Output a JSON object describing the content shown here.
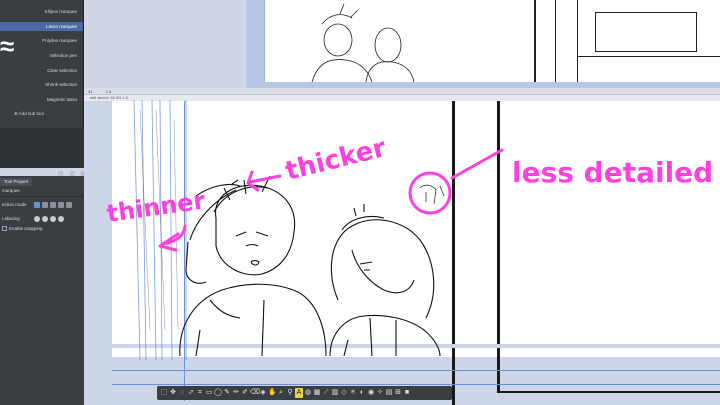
{
  "subtool_panel": {
    "items": [
      {
        "label": "Ellipse marquee"
      },
      {
        "label": "Lasso marquee"
      },
      {
        "label": "Polyline marquee"
      },
      {
        "label": "Selection pen"
      },
      {
        "label": "Clear selection"
      },
      {
        "label": "Shrink selection"
      },
      {
        "label": "Magnetic lasso"
      }
    ],
    "selected_index": 1,
    "add_sub_tool": "Add sub tool"
  },
  "tool_property": {
    "tab_label": "Tool Propert",
    "tool_name": "marquee",
    "rows": [
      {
        "label": "ection mode"
      },
      {
        "label": "i-aliasing"
      },
      {
        "label": "Enable snapping"
      }
    ]
  },
  "canvas": {
    "titlebar": "41            1.5",
    "tab": "stdi sketch 18.3% 1.5"
  },
  "annotations": {
    "thicker": "thicker",
    "thinner": "thinner",
    "less_detailed": "less detailed"
  },
  "colors": {
    "annotation": "#ff3fe0",
    "panel_bg": "#3a3d42",
    "selection_blue": "#4a6aa6",
    "guide_blue": "#6d8fd6"
  },
  "bottom_toolbar": {
    "icons": [
      "select-icon",
      "move-icon",
      "lasso-icon",
      "transform-icon",
      "crop-icon",
      "rect-icon",
      "ellipse-icon",
      "pen-icon",
      "pencil-icon",
      "brush-icon",
      "eraser-icon",
      "fill-icon",
      "grab-icon",
      "zoom-icon",
      "eyedrop-icon",
      "text-icon",
      "balloon-icon",
      "frame-icon",
      "ruler-icon",
      "gradient-icon",
      "figure-icon",
      "blend-icon",
      "correct-icon",
      "airbrush-icon",
      "decoration-icon",
      "layer-icon",
      "mesh-icon",
      "color-icon"
    ],
    "active_index": 15
  }
}
